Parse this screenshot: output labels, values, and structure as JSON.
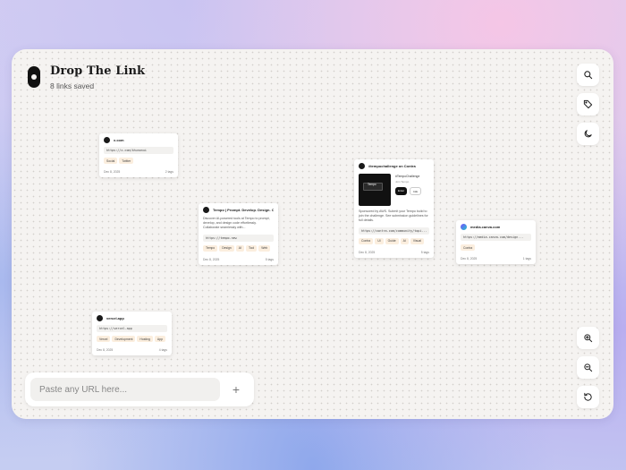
{
  "app": {
    "title": "Drop The Link",
    "subtitle": "8 links saved"
  },
  "tools_top": [
    {
      "name": "search-icon"
    },
    {
      "name": "tag-icon"
    },
    {
      "name": "moon-icon"
    }
  ],
  "tools_bottom": [
    {
      "name": "zoom-in-icon"
    },
    {
      "name": "zoom-out-icon"
    },
    {
      "name": "reset-icon"
    }
  ],
  "cards": {
    "x": {
      "title": "x.com",
      "url": "https://x.com/khunonui",
      "tags": [
        "Social",
        "Twitter"
      ],
      "date": "Dec 8, 2025",
      "tag_count": "2 tags"
    },
    "tempo": {
      "title": "Tempo | Prompt. Develop. Design. C...",
      "description": "Discover AI-powered tools at Tempo to prompt, develop, and design code effortlessly. Collaborate seamlessly with...",
      "url": "https://tempo.new",
      "tags": [
        "Tempo",
        "Design",
        "AI",
        "Tool",
        "Web"
      ],
      "date": "Dec 8, 2025",
      "tag_count": "5 tags"
    },
    "contra": {
      "title": "#tempochallenge on Contra",
      "preview_label": "Tempo",
      "preview_heading": "#TempoChallenge",
      "preview_small": "Join Tempo",
      "pill_join": "Enter",
      "pill_info": "Info",
      "description": "Sponsored by AWS. Submit your Tempo build to join the challenge. See submission guidelines for full details.",
      "url": "https://contra.com/community/topi...",
      "tags": [
        "Contra",
        "UI",
        "Guide",
        "AI",
        "Visual"
      ],
      "date": "Dec 8, 2025",
      "tag_count": "5 tags"
    },
    "canva": {
      "title": "media.canva.com",
      "url": "https://media.canva.com/design...",
      "tags": [
        "Contra"
      ],
      "date": "Dec 8, 2025",
      "tag_count": "1 tags"
    },
    "vercel": {
      "title": "vercel.app",
      "url": "https://vercel.app",
      "tags": [
        "Vercel",
        "Development",
        "Hosting",
        "App"
      ],
      "date": "Dec 8, 2025",
      "tag_count": "4 tags"
    }
  },
  "input": {
    "placeholder": "Paste any URL here...",
    "value": "",
    "add_label": "+"
  }
}
